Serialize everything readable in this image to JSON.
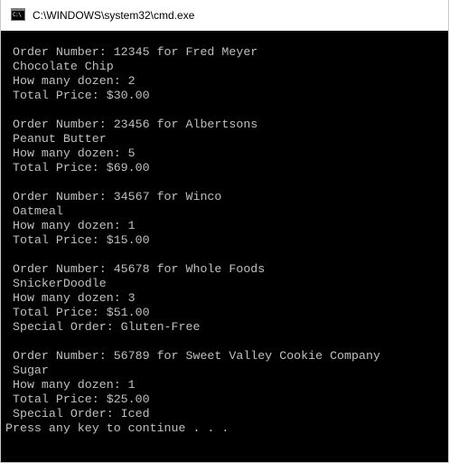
{
  "window": {
    "title": "C:\\WINDOWS\\system32\\cmd.exe",
    "icon_glyph": "C:\\",
    "icon_name": "cmd-console-icon"
  },
  "console": {
    "lines": [
      "",
      " Order Number: 12345 for Fred Meyer",
      " Chocolate Chip",
      " How many dozen: 2",
      " Total Price: $30.00",
      "",
      " Order Number: 23456 for Albertsons",
      " Peanut Butter",
      " How many dozen: 5",
      " Total Price: $69.00",
      "",
      " Order Number: 34567 for Winco",
      " Oatmeal",
      " How many dozen: 1",
      " Total Price: $15.00",
      "",
      " Order Number: 45678 for Whole Foods",
      " SnickerDoodle",
      " How many dozen: 3",
      " Total Price: $51.00",
      " Special Order: Gluten-Free",
      "",
      " Order Number: 56789 for Sweet Valley Cookie Company",
      " Sugar",
      " How many dozen: 1",
      " Total Price: $25.00",
      " Special Order: Iced",
      "Press any key to continue . . ."
    ]
  },
  "colors": {
    "console_background": "#000000",
    "console_text": "#c0c0c0",
    "titlebar_background": "#ffffff"
  }
}
